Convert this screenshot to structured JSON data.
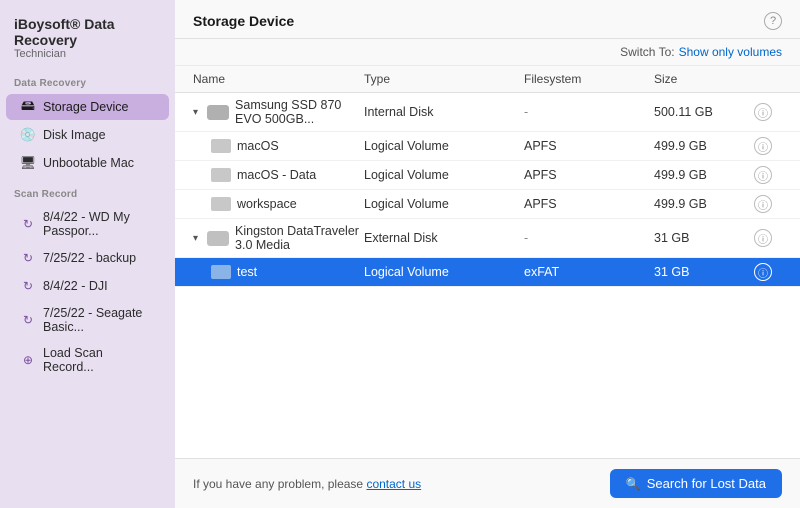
{
  "app": {
    "title": "iBoysoft® Data Recovery",
    "subtitle": "Technician"
  },
  "sidebar": {
    "data_recovery_label": "Data Recovery",
    "items": [
      {
        "id": "storage-device",
        "label": "Storage Device",
        "active": true
      },
      {
        "id": "disk-image",
        "label": "Disk Image",
        "active": false
      },
      {
        "id": "unbootable-mac",
        "label": "Unbootable Mac",
        "active": false
      }
    ],
    "scan_record_label": "Scan Record",
    "scan_items": [
      {
        "id": "scan1",
        "label": "8/4/22 - WD My Passpor..."
      },
      {
        "id": "scan2",
        "label": "7/25/22 - backup"
      },
      {
        "id": "scan3",
        "label": "8/4/22 - DJI"
      },
      {
        "id": "scan4",
        "label": "7/25/22 - Seagate Basic..."
      }
    ],
    "load_label": "Load Scan Record..."
  },
  "main": {
    "title": "Storage Device",
    "help_label": "?",
    "switch_label": "Switch To:",
    "switch_link_label": "Show only volumes",
    "table": {
      "headers": [
        "Name",
        "Type",
        "Filesystem",
        "Size",
        ""
      ],
      "rows": [
        {
          "id": "row-samsung",
          "indent": 0,
          "chevron": "▾",
          "icon": "hdd",
          "name": "Samsung SSD 870 EVO 500GB...",
          "type": "Internal Disk",
          "filesystem": "-",
          "size": "500.11 GB",
          "selected": false,
          "is_parent": true
        },
        {
          "id": "row-macos",
          "indent": 1,
          "chevron": "",
          "icon": "vol",
          "name": "macOS",
          "type": "Logical Volume",
          "filesystem": "APFS",
          "size": "499.9 GB",
          "selected": false,
          "is_parent": false
        },
        {
          "id": "row-macos-data",
          "indent": 1,
          "chevron": "",
          "icon": "vol",
          "name": "macOS - Data",
          "type": "Logical Volume",
          "filesystem": "APFS",
          "size": "499.9 GB",
          "selected": false,
          "is_parent": false
        },
        {
          "id": "row-workspace",
          "indent": 1,
          "chevron": "",
          "icon": "vol",
          "name": "workspace",
          "type": "Logical Volume",
          "filesystem": "APFS",
          "size": "499.9 GB",
          "selected": false,
          "is_parent": false
        },
        {
          "id": "row-kingston",
          "indent": 0,
          "chevron": "▾",
          "icon": "usb",
          "name": "Kingston DataTraveler 3.0 Media",
          "type": "External Disk",
          "filesystem": "-",
          "size": "31 GB",
          "selected": false,
          "is_parent": true
        },
        {
          "id": "row-test",
          "indent": 1,
          "chevron": "",
          "icon": "vol",
          "name": "test",
          "type": "Logical Volume",
          "filesystem": "exFAT",
          "size": "31 GB",
          "selected": true,
          "is_parent": false
        }
      ]
    }
  },
  "footer": {
    "text": "If you have any problem, please",
    "link_label": "contact us",
    "search_button_label": "Search for Lost Data"
  }
}
